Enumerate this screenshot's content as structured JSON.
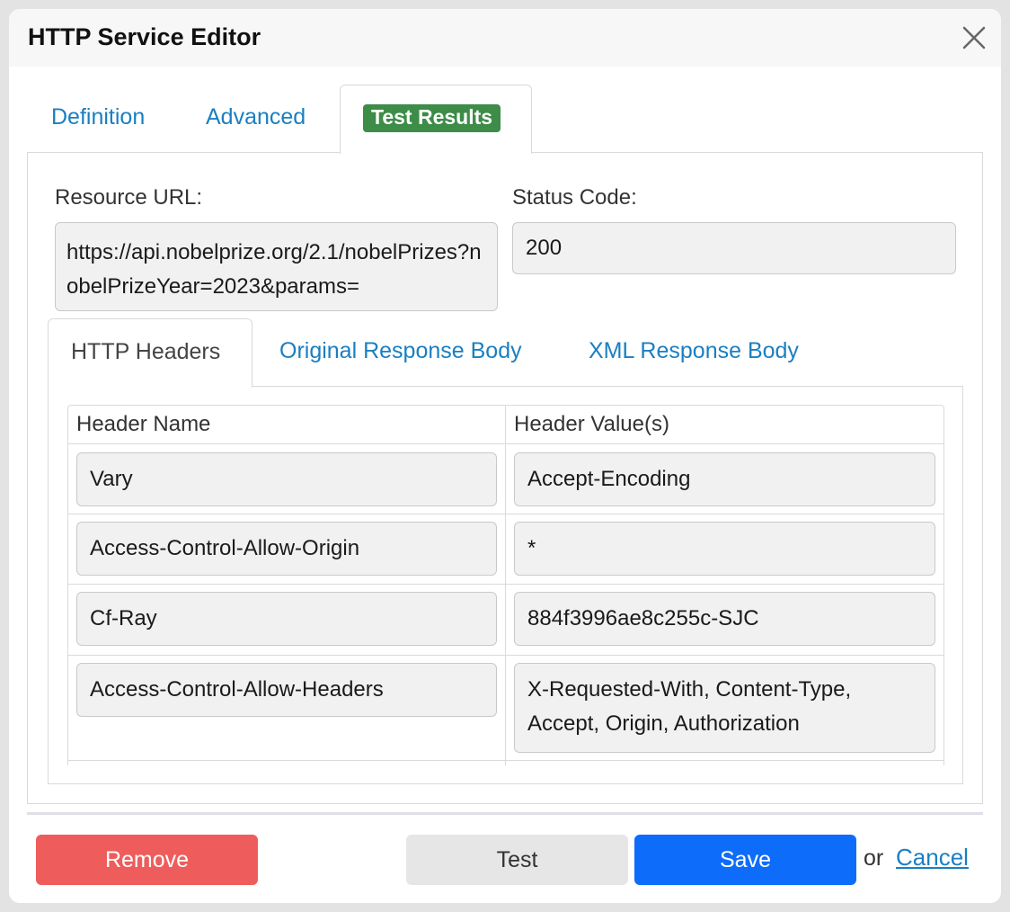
{
  "dialog": {
    "title": "HTTP Service Editor",
    "close_icon": "close-icon"
  },
  "tabs": [
    {
      "label": "Definition",
      "active": false
    },
    {
      "label": "Advanced",
      "active": false
    },
    {
      "label": "Test Results",
      "active": true
    }
  ],
  "fields": {
    "resource_url_label": "Resource URL:",
    "resource_url_value": "https://api.nobelprize.org/2.1/nobelPrizes?nobelPrizeYear=2023&params=",
    "status_code_label": "Status Code:",
    "status_code_value": "200"
  },
  "inner_tabs": [
    {
      "label": "HTTP Headers",
      "active": true
    },
    {
      "label": "Original Response Body",
      "active": false
    },
    {
      "label": "XML Response Body",
      "active": false
    }
  ],
  "headers_table": {
    "columns": [
      "Header Name",
      "Header Value(s)"
    ],
    "rows": [
      {
        "name": "Vary",
        "value": "Accept-Encoding"
      },
      {
        "name": "Access-Control-Allow-Origin",
        "value": "*"
      },
      {
        "name": "Cf-Ray",
        "value": "884f3996ae8c255c-SJC"
      },
      {
        "name": "Access-Control-Allow-Headers",
        "value": "X-Requested-With, Content-Type, Accept, Origin, Authorization"
      }
    ]
  },
  "footer": {
    "remove_label": "Remove",
    "test_label": "Test",
    "save_label": "Save",
    "or_text": "or",
    "cancel_label": "Cancel"
  },
  "colors": {
    "active_tab_pill": "#3d8c48",
    "link": "#1a7fc1",
    "remove": "#ee5d5b",
    "save": "#0e6cfb",
    "test": "#e6e6e6"
  }
}
